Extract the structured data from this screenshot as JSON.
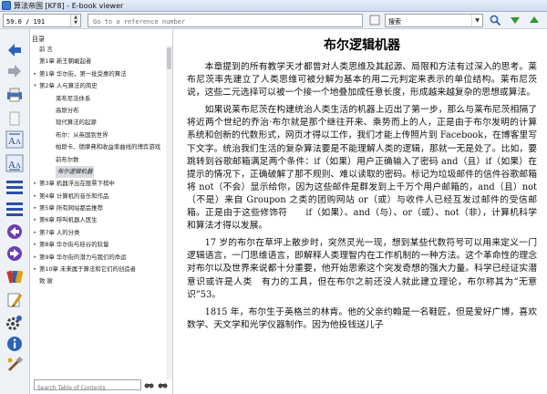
{
  "window": {
    "title": "算法帝国 [KF8] - E-book viewer"
  },
  "toolbar": {
    "position_value": "59.0 / 191",
    "reference_placeholder": "Go to a reference number",
    "search_value": "搜索",
    "icons": [
      "search-icon",
      "arrow-down-icon",
      "arrow-up-icon"
    ]
  },
  "sidebar": {
    "icons": [
      "back-arrow-icon",
      "forward-arrow-icon",
      "print-icon",
      "copy-icon",
      "font-larger-icon",
      "font-smaller-icon",
      "menu-icon",
      "chapter-list-icon",
      "previous-icon",
      "next-icon",
      "bookmark-icon",
      "reference-mode-icon",
      "settings-icon",
      "info-icon",
      "tools-icon"
    ],
    "colors": {
      "accent": "#2a63b8",
      "nav": "#6a3fb0"
    }
  },
  "toc": {
    "heading": "目录",
    "items": [
      {
        "label": "前 言",
        "level": 1,
        "toggle": ""
      },
      {
        "label": "第1章 新王朝崛起者",
        "level": 1,
        "toggle": ""
      },
      {
        "label": "第1章 华尔街，第一批受惠的算法",
        "level": 0,
        "toggle": "▸"
      },
      {
        "label": "第2章 人与算法的简史",
        "level": 0,
        "toggle": "▾"
      },
      {
        "label": "莱布尼茨体系",
        "level": 2,
        "toggle": ""
      },
      {
        "label": "高斯分布",
        "level": 2,
        "toggle": ""
      },
      {
        "label": "现代算法的起源",
        "level": 2,
        "toggle": ""
      },
      {
        "label": "布尔：从英国到世界",
        "level": 2,
        "toggle": ""
      },
      {
        "label": "帕斯卡、德摩弗和收益率曲线的博弈游戏",
        "level": 2,
        "toggle": ""
      },
      {
        "label": "前布尔数",
        "level": 2,
        "toggle": ""
      },
      {
        "label": "布尔逻辑机器",
        "level": 2,
        "toggle": "",
        "selected": true
      },
      {
        "label": "第3章 机器浮出在股票下棋中",
        "level": 0,
        "toggle": "▸"
      },
      {
        "label": "第4章 计算机的音乐和作品",
        "level": 0,
        "toggle": "▸"
      },
      {
        "label": "第5章 所有网站都会推荐",
        "level": 0,
        "toggle": "▸"
      },
      {
        "label": "第6章 呼叫机器人医生",
        "level": 0,
        "toggle": "▸"
      },
      {
        "label": "第7章 人的分类",
        "level": 0,
        "toggle": "▸"
      },
      {
        "label": "第8章 华尔街与硅谷的较量",
        "level": 0,
        "toggle": "▸"
      },
      {
        "label": "第9章 华尔街的潜力与我们的命运",
        "level": 0,
        "toggle": "▸"
      },
      {
        "label": "第10章 未来属于算法和它们的创造者",
        "level": 0,
        "toggle": "▸"
      },
      {
        "label": "致 谢",
        "level": 1,
        "toggle": ""
      }
    ],
    "search_placeholder": "Search Table of Contents"
  },
  "content": {
    "title": "布尔逻辑机器",
    "paragraphs": [
      "本章提到的所有教学天才都曾对人类思维及其起源、局限和方法有过深入的思考。莱布尼茨率先建立了人类思维可被分解为基本的用二元判定来表示的单位结构。莱布尼茨说，这些二元选择可以被一个接一个地叠加成任意长度，形成越来越复杂的思想或算法。",
      "如果说莱布尼茨在构建统治人类生活的机器上迈出了第一步，那么与莱布尼茨相隔了将近两个世纪的乔治·布尔就是那个继往开来、乘势而上的人，正是由于布尔发明的计算系统和创新的代数形式，网页才得以工作，我们才能上传照片到 Facebook，在博客里写下文字。统治我们生活的复杂算法要是不能理解人类的逻辑，那就一无是处了。比如，要跳转到谷歌邮箱满足两个条件：if（如果）用户正确输入了密码 and（且）if（如果）在提示的情况下，正确破解了那不规则、难以读取的密码。标记为垃圾邮件的信件谷歌邮箱将 not（不会）显示给你，因为这些邮件是群发到上千万个用户邮箱的，and（且）not（不是）来自 Groupon 之类的团购网站 or（或）与收件人已经互发过邮件的受信邮箱。正是由于这些修饰符　　if（如果）、and（与）、or（或）、not（非），计算机科学和算法才得以发展。",
      "17 岁的布尔在草坪上散步时，突然灵光一现，想到某些代数符号可以用来定义一门逻辑语言，一门思维语言，即解释人类理智内在工作机制的一种方法。这个革命性的理念对布尔以及世界来说都十分重要，他开始思索这个突发奇想的强大力量。科学已经证实潜意识或许是人类　有力的工具，但在布尔之前还没人就此建立理论，布尔称其为“无意识”53。",
      "1815 年，布尔生于英格兰的林肯。他的父亲约翰是一名鞋匠，但是爱好广博，喜欢数学、天文学和光学仪器制作。因为他投钱送儿子"
    ]
  }
}
